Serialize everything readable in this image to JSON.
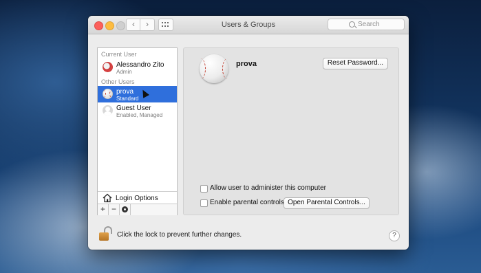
{
  "window": {
    "title": "Users & Groups",
    "nav_back": "‹",
    "nav_forward": "›",
    "search_placeholder": "Search"
  },
  "sidebar": {
    "current_user_label": "Current User",
    "current_user": {
      "name": "Alessandro Zito",
      "role": "Admin"
    },
    "other_users_label": "Other Users",
    "other_users": [
      {
        "name": "prova",
        "role": "Standard",
        "selected": true
      },
      {
        "name": "Guest User",
        "role": "Enabled, Managed",
        "selected": false
      }
    ],
    "login_options_label": "Login Options",
    "add_label": "+",
    "remove_label": "−"
  },
  "main": {
    "username": "prova",
    "reset_password_label": "Reset Password...",
    "allow_admin_label": "Allow user to administer this computer",
    "allow_admin_checked": false,
    "parental_controls_label": "Enable parental controls",
    "parental_controls_checked": false,
    "open_parental_label": "Open Parental Controls..."
  },
  "footer": {
    "lock_text": "Click the lock to prevent further changes.",
    "help_label": "?"
  },
  "colors": {
    "selection": "#2f6fdc",
    "lock": "#d08e35"
  }
}
